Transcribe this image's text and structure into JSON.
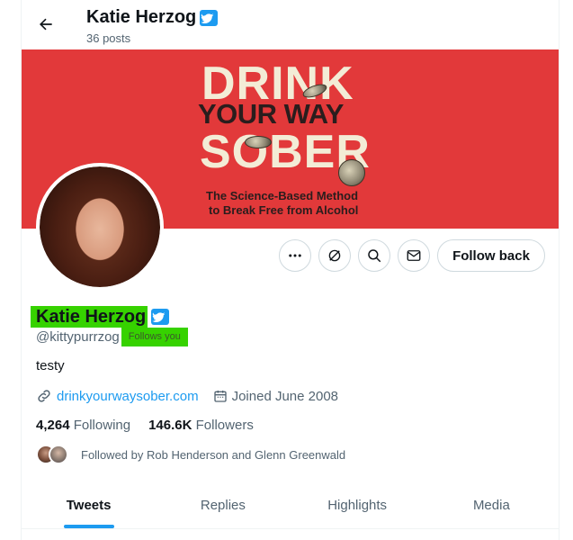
{
  "header": {
    "name": "Katie Herzog",
    "posts": "36 posts"
  },
  "banner": {
    "line1": "DRINK",
    "line2": "YOUR WAY",
    "line3": "SOBER",
    "sub1": "The Science-Based Method",
    "sub2": "to Break Free from Alcohol"
  },
  "actions": {
    "follow_label": "Follow back"
  },
  "profile": {
    "name": "Katie Herzog",
    "handle": "@kittypurrzog",
    "follows_you": "Follows you",
    "bio": "testy",
    "website": "drinkyourwaysober.com",
    "joined": "Joined June 2008",
    "following_count": "4,264",
    "following_label": "Following",
    "followers_count": "146.6K",
    "followers_label": "Followers",
    "followed_by": "Followed by Rob Henderson and Glenn Greenwald"
  },
  "tabs": [
    {
      "label": "Tweets",
      "active": true
    },
    {
      "label": "Replies",
      "active": false
    },
    {
      "label": "Highlights",
      "active": false
    },
    {
      "label": "Media",
      "active": false
    }
  ],
  "colors": {
    "accent": "#1d9bf0",
    "banner": "#e2393a",
    "highlight": "#36d200",
    "verified": "#1d9bf0"
  }
}
